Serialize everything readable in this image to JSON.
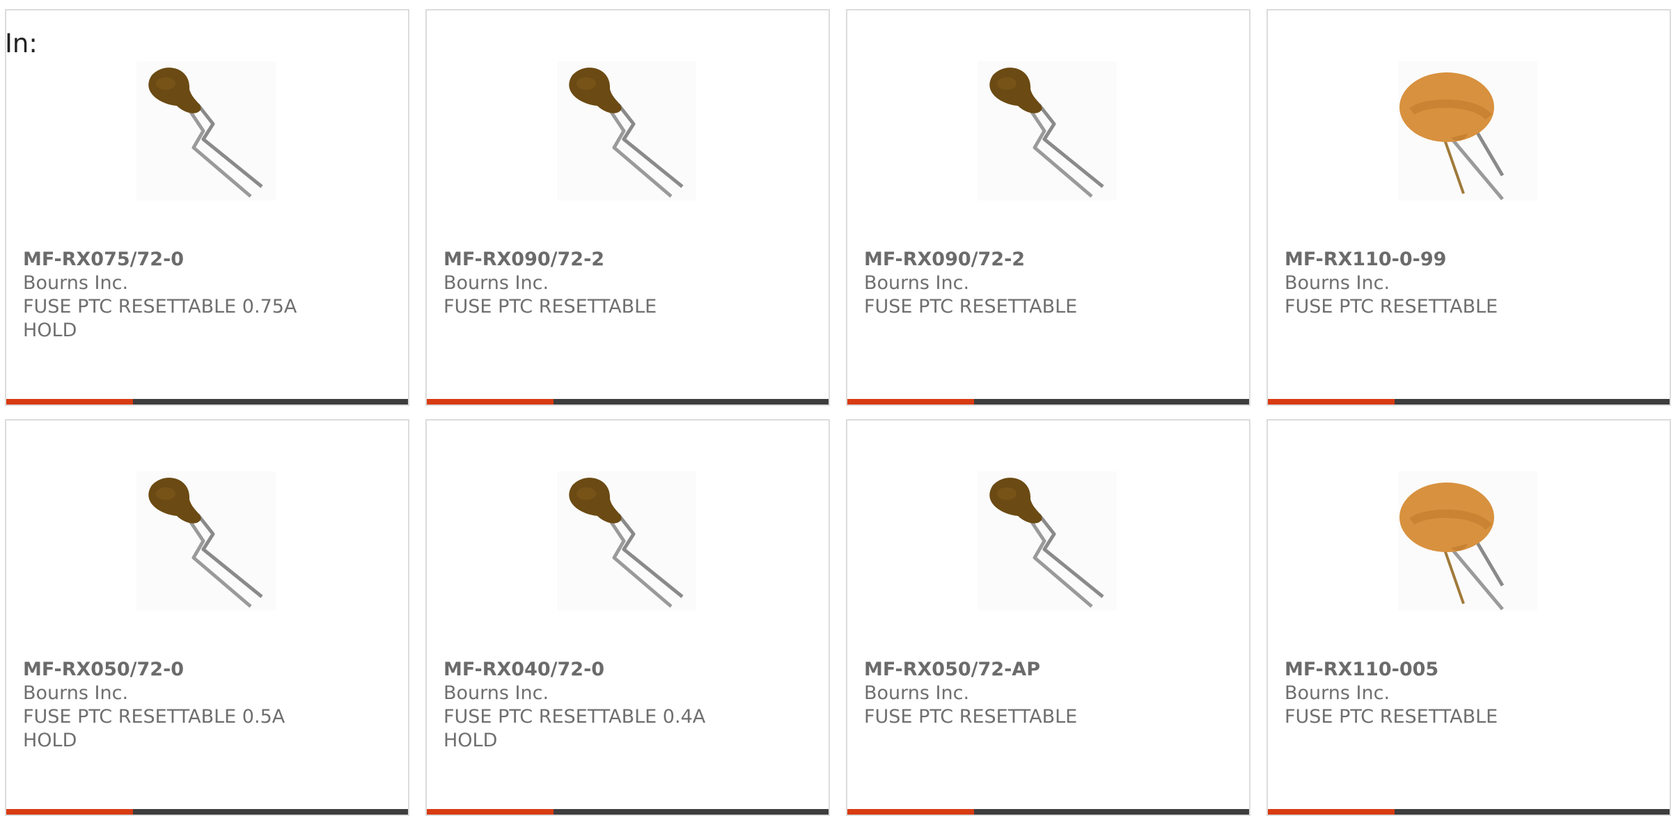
{
  "filter": {
    "label": "In:"
  },
  "colors": {
    "accent": "#d83b12",
    "bar": "#3e3e3e",
    "text": "#6f6f6f",
    "border": "#dcdcdc"
  },
  "products": [
    {
      "part_number": "MF-RX075/72-0",
      "manufacturer": "Bourns Inc.",
      "desc_line1": "FUSE PTC RESETTABLE 0.75A",
      "desc_line2": "HOLD",
      "image_icon": "radial-ptc-small-icon"
    },
    {
      "part_number": "MF-RX090/72-2",
      "manufacturer": "Bourns Inc.",
      "desc_line1": "FUSE PTC RESETTABLE",
      "desc_line2": "",
      "image_icon": "radial-ptc-small-icon"
    },
    {
      "part_number": "MF-RX090/72-2",
      "manufacturer": "Bourns Inc.",
      "desc_line1": "FUSE PTC RESETTABLE",
      "desc_line2": "",
      "image_icon": "radial-ptc-small-icon"
    },
    {
      "part_number": "MF-RX110-0-99",
      "manufacturer": "Bourns Inc.",
      "desc_line1": "FUSE PTC RESETTABLE",
      "desc_line2": "",
      "image_icon": "radial-ptc-large-icon"
    },
    {
      "part_number": "MF-RX050/72-0",
      "manufacturer": "Bourns Inc.",
      "desc_line1": "FUSE PTC RESETTABLE 0.5A",
      "desc_line2": "HOLD",
      "image_icon": "radial-ptc-small-icon"
    },
    {
      "part_number": "MF-RX040/72-0",
      "manufacturer": "Bourns Inc.",
      "desc_line1": "FUSE PTC RESETTABLE 0.4A",
      "desc_line2": "HOLD",
      "image_icon": "radial-ptc-small-icon"
    },
    {
      "part_number": "MF-RX050/72-AP",
      "manufacturer": "Bourns Inc.",
      "desc_line1": "FUSE PTC RESETTABLE",
      "desc_line2": "",
      "image_icon": "radial-ptc-small-icon"
    },
    {
      "part_number": "MF-RX110-005",
      "manufacturer": "Bourns Inc.",
      "desc_line1": "FUSE PTC RESETTABLE",
      "desc_line2": "",
      "image_icon": "radial-ptc-large-icon"
    }
  ]
}
